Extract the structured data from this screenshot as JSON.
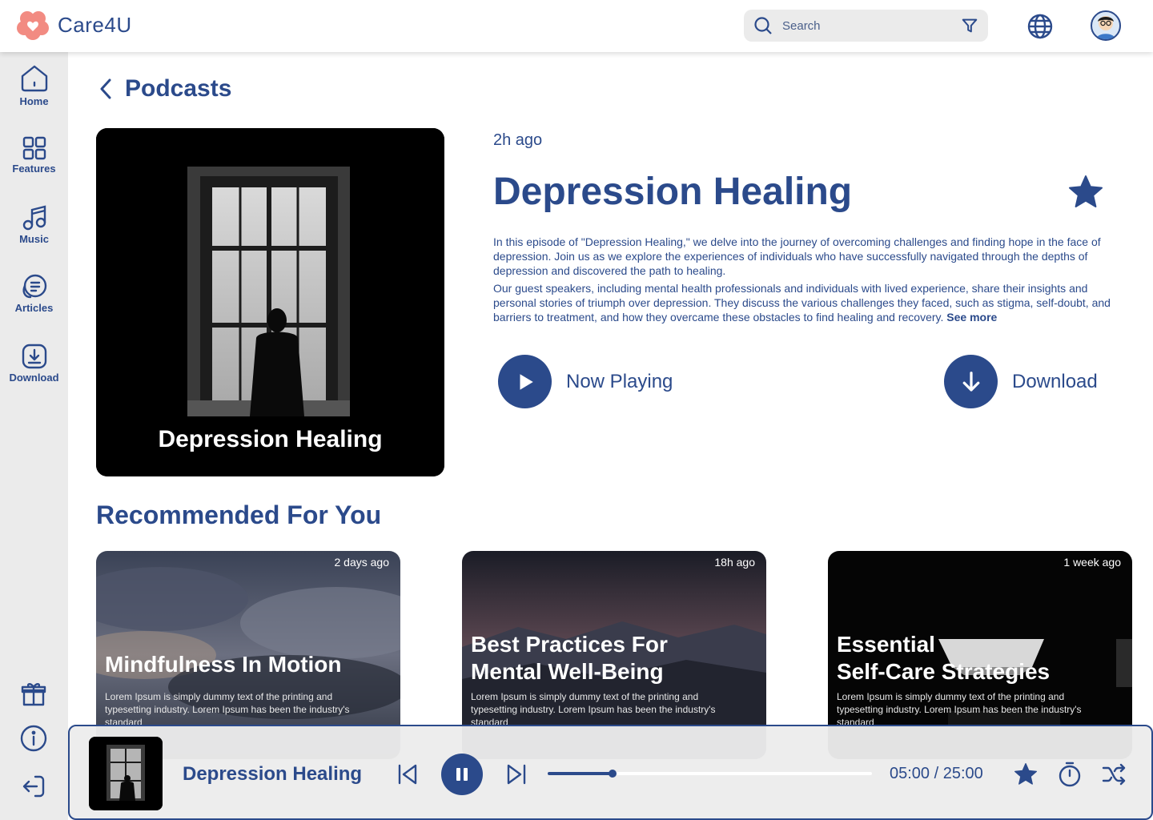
{
  "app": {
    "name": "Care4U"
  },
  "search": {
    "placeholder": "Search"
  },
  "sidebar": {
    "items": [
      {
        "label": "Home",
        "icon": "home-icon"
      },
      {
        "label": "Features",
        "icon": "grid-icon"
      },
      {
        "label": "Music",
        "icon": "music-icon"
      },
      {
        "label": "Articles",
        "icon": "articles-icon"
      },
      {
        "label": "Download",
        "icon": "download-icon"
      }
    ],
    "bottom_icons": [
      "gift-icon",
      "info-icon",
      "logout-icon"
    ]
  },
  "page": {
    "title": "Podcasts"
  },
  "episode": {
    "cover_title": "Depression Healing",
    "time_ago": "2h ago",
    "title": "Depression Healing",
    "description_1": "In this episode of \"Depression Healing,\" we delve into the journey of overcoming challenges and finding hope in the face of depression. Join us as we explore the experiences of individuals who have successfully navigated through the depths of depression and discovered the path to healing.",
    "description_2": "Our guest speakers, including mental health professionals and individuals with lived experience, share their insights and personal stories of triumph over depression. They discuss the various challenges they faced, such as stigma, self-doubt, and barriers to treatment, and how they overcame these obstacles to find healing and recovery.",
    "see_more": "See more",
    "now_playing_label": "Now Playing",
    "download_label": "Download"
  },
  "recommended": {
    "title": "Recommended For You",
    "cards": [
      {
        "time_ago": "2 days ago",
        "title": "Mindfulness In Motion",
        "description": "Lorem Ipsum is simply dummy text of the printing and typesetting industry. Lorem Ipsum has been the industry's standard"
      },
      {
        "time_ago": "18h ago",
        "title_line1": "Best Practices For",
        "title_line2": "Mental Well-Being",
        "description": "Lorem Ipsum is simply dummy text of the printing and typesetting industry. Lorem Ipsum has been the industry's standard"
      },
      {
        "time_ago": "1 week ago",
        "title_line1": "Essential",
        "title_line2": "Self-Care Strategies",
        "description": "Lorem Ipsum is simply dummy text of the printing and typesetting industry. Lorem Ipsum has been the industry's standard"
      }
    ]
  },
  "player": {
    "title": "Depression Healing",
    "time": "05:00 / 25:00",
    "progress": 0.2
  },
  "colors": {
    "primary": "#2b4a8b",
    "sidebar_bg": "#ebebeb",
    "logo_accent": "#f28b82"
  }
}
